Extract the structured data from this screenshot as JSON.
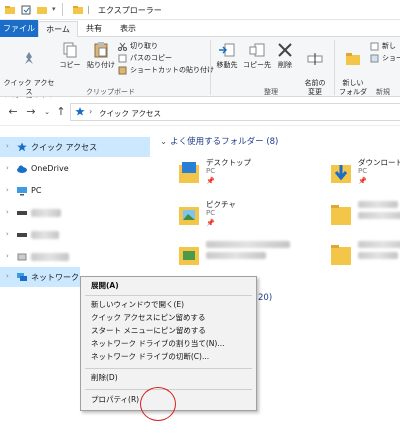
{
  "window": {
    "title": "エクスプローラー"
  },
  "ribbon_tabs": [
    "ファイル",
    "ホーム",
    "共有",
    "表示"
  ],
  "ribbon": {
    "clipboard": {
      "pin_quick_access": "クイック アクセス\nにピン留めする",
      "copy": "コピー",
      "paste": "貼り付け",
      "cut": "切り取り",
      "copy_path": "パスのコピー",
      "paste_shortcut": "ショートカットの貼り付け",
      "group_label": "クリップボード"
    },
    "organize": {
      "move_to": "移動先",
      "copy_to": "コピー先",
      "delete": "削除",
      "rename": "名前の\n変更",
      "group_label": "整理"
    },
    "new": {
      "new_folder": "新しい\nフォルダー",
      "new_item": "新し",
      "shortcut": "ショー",
      "group_label": "新規"
    }
  },
  "address": {
    "crumb": "クイック アクセス"
  },
  "nav_pane": {
    "items": [
      {
        "label": "クイック アクセス",
        "icon": "star-icon",
        "selected": true
      },
      {
        "label": "OneDrive",
        "icon": "cloud-icon"
      },
      {
        "label": "PC",
        "icon": "monitor-icon"
      },
      {
        "label": "",
        "icon": "drive-icon",
        "blurred": true
      },
      {
        "label": "",
        "icon": "drive-icon",
        "blurred": true
      },
      {
        "label": "",
        "icon": "usb-icon",
        "blurred": true
      },
      {
        "label": "ネットワーク",
        "icon": "network-icon",
        "selected": true
      }
    ]
  },
  "content": {
    "section_title": "よく使用するフォルダー (8)",
    "section2_fragment": "20)",
    "tiles": [
      {
        "name": "デスクトップ",
        "sub": "PC",
        "pinned": true,
        "folder": "desktop-folder-icon"
      },
      {
        "name": "ダウンロード",
        "sub": "PC",
        "pinned": true,
        "folder": "download-folder-icon"
      },
      {
        "name": "ピクチャ",
        "sub": "PC",
        "pinned": true,
        "folder": "pictures-folder-icon"
      },
      {
        "name": "",
        "sub": "",
        "blurred": true,
        "folder": "folder-icon"
      },
      {
        "name": "",
        "sub": "",
        "blurred": true,
        "folder": "folder-icon"
      },
      {
        "name": "",
        "sub": "",
        "blurred": true,
        "folder": "folder-icon"
      }
    ]
  },
  "context_menu": {
    "items": [
      {
        "label": "展開(A)",
        "bold": true
      },
      {
        "sep": true
      },
      {
        "label": "新しいウィンドウで開く(E)"
      },
      {
        "label": "クイック アクセスにピン留めする"
      },
      {
        "label": "スタート メニューにピン留めする"
      },
      {
        "label": "ネットワーク ドライブの割り当て(N)..."
      },
      {
        "label": "ネットワーク ドライブの切断(C)..."
      },
      {
        "sep": true
      },
      {
        "label": "削除(D)"
      },
      {
        "sep": true
      },
      {
        "label": "プロパティ(R)"
      }
    ]
  },
  "colors": {
    "accent": "#1a6ec7",
    "selection": "#cce8ff",
    "folder": "#f3c64a",
    "annotation": "#d42020"
  }
}
